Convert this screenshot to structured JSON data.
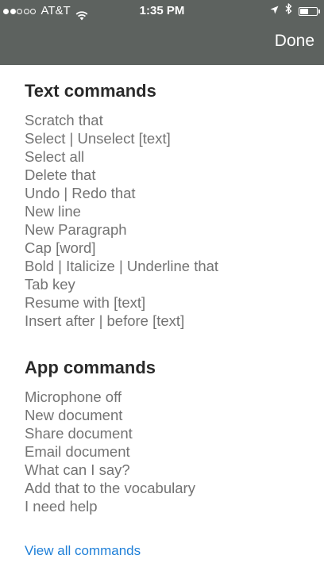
{
  "status_bar": {
    "carrier": "AT&T",
    "time": "1:35 PM",
    "signal_bars_filled": 2,
    "signal_bars_total": 5,
    "battery_level": 0.55,
    "icons": [
      "wifi-icon",
      "location-arrow-icon",
      "bluetooth-icon",
      "battery-icon"
    ]
  },
  "header": {
    "done_label": "Done",
    "background": "#5d625f"
  },
  "text_commands": {
    "title": "Text commands",
    "items": [
      "Scratch that",
      "Select | Unselect [text]",
      "Select all",
      "Delete that",
      "Undo | Redo that",
      "New line",
      "New Paragraph",
      "Cap [word]",
      "Bold | Italicize | Underline that",
      "Tab key",
      "Resume with [text]",
      "Insert after | before [text]"
    ]
  },
  "app_commands": {
    "title": "App commands",
    "items": [
      "Microphone off",
      "New document",
      "Share document",
      "Email document",
      "What can I say?",
      "Add that to the vocabulary",
      "I need help"
    ]
  },
  "footer": {
    "view_all_label": "View all commands",
    "link_color": "#1e7fd8"
  }
}
